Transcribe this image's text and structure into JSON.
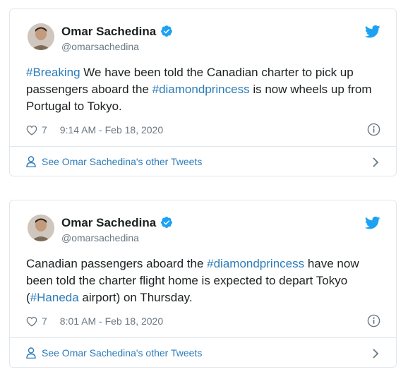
{
  "tweets": [
    {
      "author_name": "Omar Sachedina",
      "handle": "@omarsachedina",
      "text_parts": [
        {
          "text": "#Breaking",
          "tag": true
        },
        {
          "text": " We have been told the Canadian charter to pick up passengers aboard the ",
          "tag": false
        },
        {
          "text": "#diamondprincess",
          "tag": true
        },
        {
          "text": " is now wheels up from Portugal to Tokyo.",
          "tag": false
        }
      ],
      "likes": "7",
      "timestamp": "9:14 AM - Feb 18, 2020",
      "footer_link": "See Omar Sachedina's other Tweets"
    },
    {
      "author_name": "Omar Sachedina",
      "handle": "@omarsachedina",
      "text_parts": [
        {
          "text": "Canadian passengers aboard the ",
          "tag": false
        },
        {
          "text": "#diamondprincess",
          "tag": true
        },
        {
          "text": " have now been told the charter flight home is expected to depart Tokyo (",
          "tag": false
        },
        {
          "text": "#Haneda",
          "tag": true
        },
        {
          "text": " airport) on Thursday.",
          "tag": false
        }
      ],
      "likes": "7",
      "timestamp": "8:01 AM - Feb 18, 2020",
      "footer_link": "See Omar Sachedina's other Tweets"
    }
  ],
  "icons": {
    "brand": "twitter-bird-icon",
    "verified": "verified-badge-icon",
    "like": "heart-icon",
    "info": "info-icon",
    "profile": "person-icon",
    "more": "chevron-right-icon"
  },
  "colors": {
    "accent": "#1da1f2",
    "link": "#2b7bb9",
    "muted": "#697882",
    "border": "#e1e8ed"
  }
}
